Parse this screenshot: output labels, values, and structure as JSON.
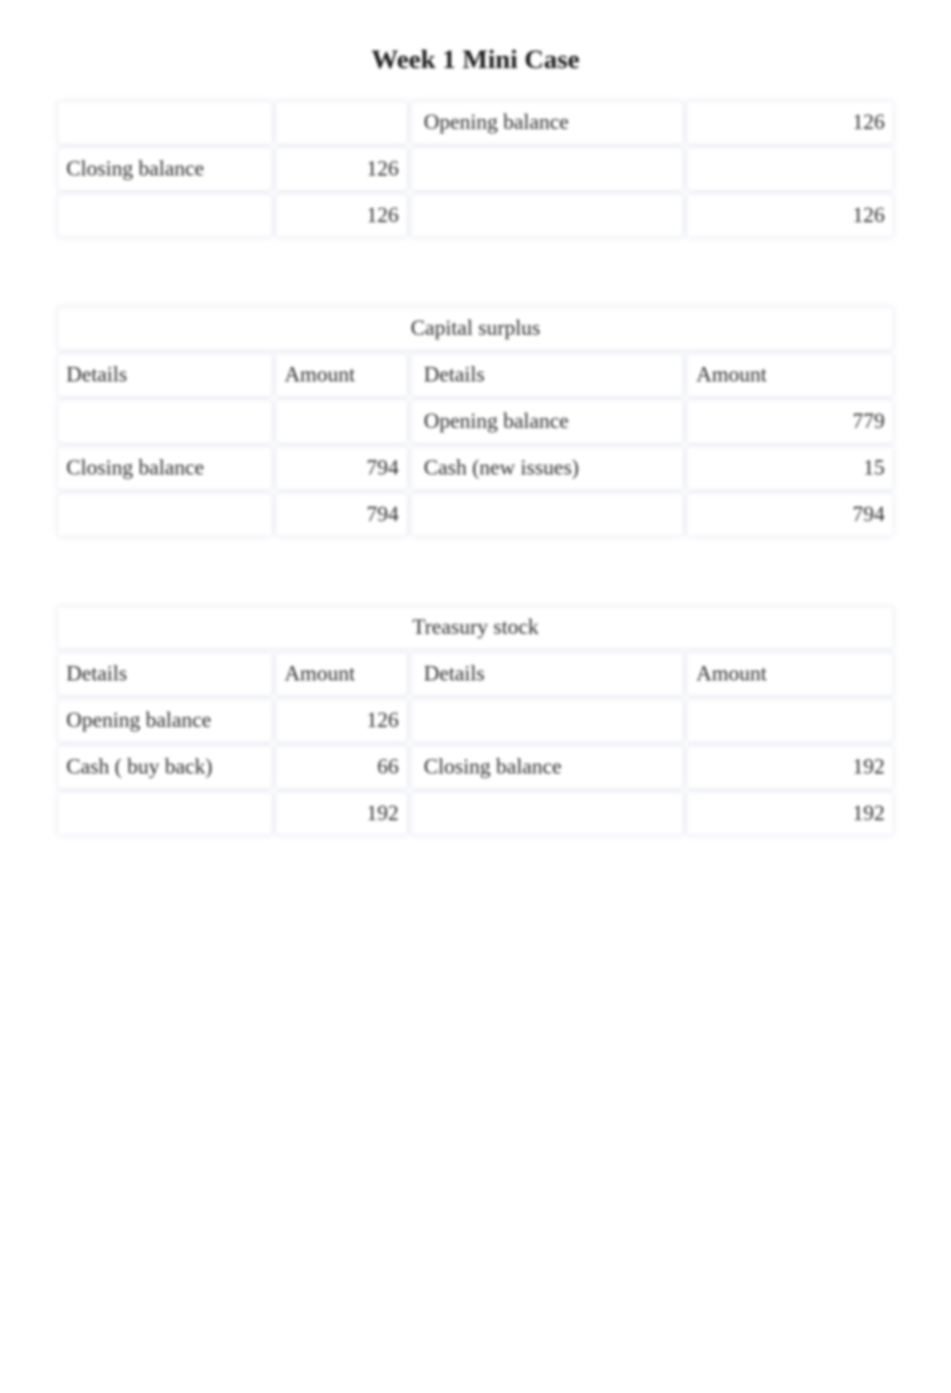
{
  "title": "Week 1 Mini Case",
  "table1": {
    "rows": [
      {
        "dl": "",
        "al": "",
        "dr": "Opening balance",
        "ar": "126"
      },
      {
        "dl": "Closing balance",
        "al": "126",
        "dr": "",
        "ar": ""
      },
      {
        "dl": "",
        "al": "126",
        "dr": "",
        "ar": "126"
      }
    ]
  },
  "table2": {
    "heading": "Capital surplus",
    "headers": {
      "dl": "Details",
      "al": "Amount",
      "dr": "Details",
      "ar": "Amount"
    },
    "rows": [
      {
        "dl": "",
        "al": "",
        "dr": "Opening balance",
        "ar": "779"
      },
      {
        "dl": "Closing balance",
        "al": "794",
        "dr": "Cash (new issues)",
        "ar": "15"
      },
      {
        "dl": "",
        "al": "794",
        "dr": "",
        "ar": "794"
      }
    ]
  },
  "table3": {
    "heading": "Treasury stock",
    "headers": {
      "dl": "Details",
      "al": "Amount",
      "dr": "Details",
      "ar": "Amount"
    },
    "rows": [
      {
        "dl": "Opening balance",
        "al": "126",
        "dr": "",
        "ar": ""
      },
      {
        "dl": "Cash ( buy back)",
        "al": "66",
        "dr": "Closing balance",
        "ar": "192"
      },
      {
        "dl": "",
        "al": "192",
        "dr": "",
        "ar": "192"
      }
    ]
  }
}
